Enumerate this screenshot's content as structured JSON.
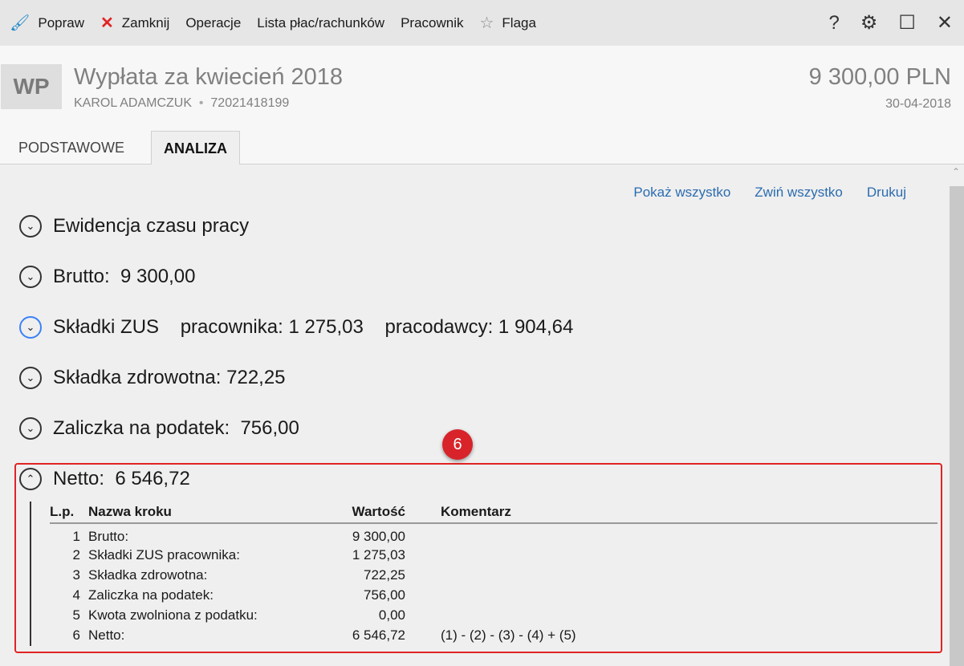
{
  "toolbar": {
    "items": [
      {
        "icon": "brush-icon",
        "label": "Popraw"
      },
      {
        "icon": "close-x-icon",
        "label": "Zamknij"
      },
      {
        "label": "Operacje"
      },
      {
        "label": "Lista płac/rachunków"
      },
      {
        "label": "Pracownik"
      },
      {
        "icon": "star-icon",
        "label": "Flaga"
      }
    ],
    "right": [
      "help-icon",
      "gear-icon",
      "maximize-icon",
      "close-icon"
    ]
  },
  "header": {
    "avatar": "WP",
    "title": "Wypłata za kwiecień 2018",
    "employee": "KAROL ADAMCZUK",
    "separator": "•",
    "pesel": "72021418199",
    "amount": "9 300,00 PLN",
    "date": "30-04-2018"
  },
  "tabs": [
    "PODSTAWOWE",
    "ANALIZA"
  ],
  "links": [
    "Pokaż wszystko",
    "Zwiń wszystko",
    "Drukuj"
  ],
  "sections": [
    "Ewidencja czasu pracy",
    "Brutto:  9 300,00",
    "Składki ZUS    pracownika: 1 275,03    pracodawcy: 1 904,64",
    "Składka zdrowotna: 722,25",
    "Zaliczka na podatek:  756,00",
    "Netto:  6 546,72"
  ],
  "badge": "6",
  "table": {
    "headers": [
      "L.p.",
      "Nazwa kroku",
      "Wartość",
      "Komentarz"
    ],
    "rows": [
      [
        "1",
        "Brutto:",
        "9 300,00",
        ""
      ],
      [
        "2",
        "Składki ZUS pracownika:",
        "1 275,03",
        ""
      ],
      [
        "3",
        "Składka zdrowotna:",
        "722,25",
        ""
      ],
      [
        "4",
        "Zaliczka na podatek:",
        "756,00",
        ""
      ],
      [
        "5",
        "Kwota zwolniona z podatku:",
        "0,00",
        ""
      ],
      [
        "6",
        "Netto:",
        "6 546,72",
        "(1) - (2) - (3) - (4) + (5)"
      ]
    ]
  },
  "colors": {
    "accent": "#2b6cb0",
    "highlight": "#e02424"
  }
}
